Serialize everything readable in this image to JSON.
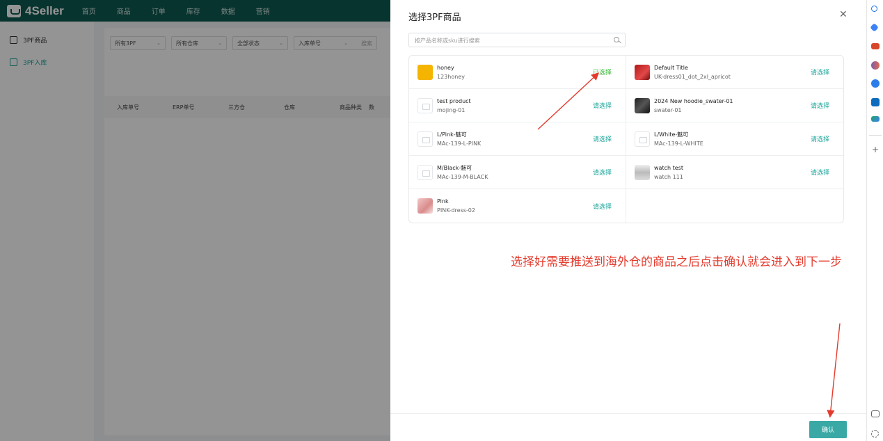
{
  "app": {
    "brand": "4Seller",
    "nav": [
      "首页",
      "商品",
      "订单",
      "库存",
      "数据",
      "营销"
    ]
  },
  "sidebar": {
    "items": [
      {
        "label": "3PF商品",
        "active": false
      },
      {
        "label": "3PF入库",
        "active": true
      }
    ]
  },
  "filters": {
    "items": [
      "所有3PF",
      "所有仓库",
      "全部状态",
      "入库单号"
    ],
    "search_placeholder": "搜索"
  },
  "table": {
    "columns": [
      "入库单号",
      "ERP单号",
      "三方仓",
      "仓库",
      "商品种类",
      "数"
    ]
  },
  "drawer": {
    "title": "选择3PF商品",
    "search_placeholder": "按产品名称或sku进行搜索",
    "select_label": "请选择",
    "selected_label": "已选择",
    "confirm_label": "确认",
    "annotation": "选择好需要推送到海外仓的商品之后点击确认就会进入到下一步",
    "products": [
      {
        "name": "honey",
        "sku": "123honey",
        "thumb": "honey",
        "status": "已选择"
      },
      {
        "name": "Default Title",
        "sku": "UK-dress01_dot_2xl_apricot",
        "thumb": "red",
        "status": "请选择"
      },
      {
        "name": "test product",
        "sku": "mojing-01",
        "thumb": "placeholder",
        "status": "请选择"
      },
      {
        "name": "2024 New hoodie_swater-01",
        "sku": "swater-01",
        "thumb": "black",
        "status": "请选择"
      },
      {
        "name": "L/Pink-魅可",
        "sku": "MAc-139-L-PINK",
        "thumb": "placeholder",
        "status": "请选择"
      },
      {
        "name": "L/White-魅可",
        "sku": "MAc-139-L-WHITE",
        "thumb": "placeholder",
        "status": "请选择"
      },
      {
        "name": "M/Black-魅可",
        "sku": "MAc-139-M-BLACK",
        "thumb": "placeholder",
        "status": "请选择"
      },
      {
        "name": "watch test",
        "sku": "watch 111",
        "thumb": "watch",
        "status": "请选择"
      },
      {
        "name": "Pink",
        "sku": "PINK-dress-02",
        "thumb": "pink",
        "status": "请选择"
      }
    ]
  },
  "colors": {
    "nav_bg": "#0e5a52",
    "accent": "#17a398",
    "selected_green": "#2fb52f",
    "confirm_bg": "#3aa9a5",
    "annotation_red": "#e33a2c"
  },
  "right_toolbar": {
    "icons": [
      "search-icon",
      "tag-icon",
      "toolbox-icon",
      "people-icon",
      "copilot-icon",
      "outlook-icon",
      "ext-icon",
      "add-icon",
      "screenshot-icon",
      "settings-icon"
    ]
  }
}
